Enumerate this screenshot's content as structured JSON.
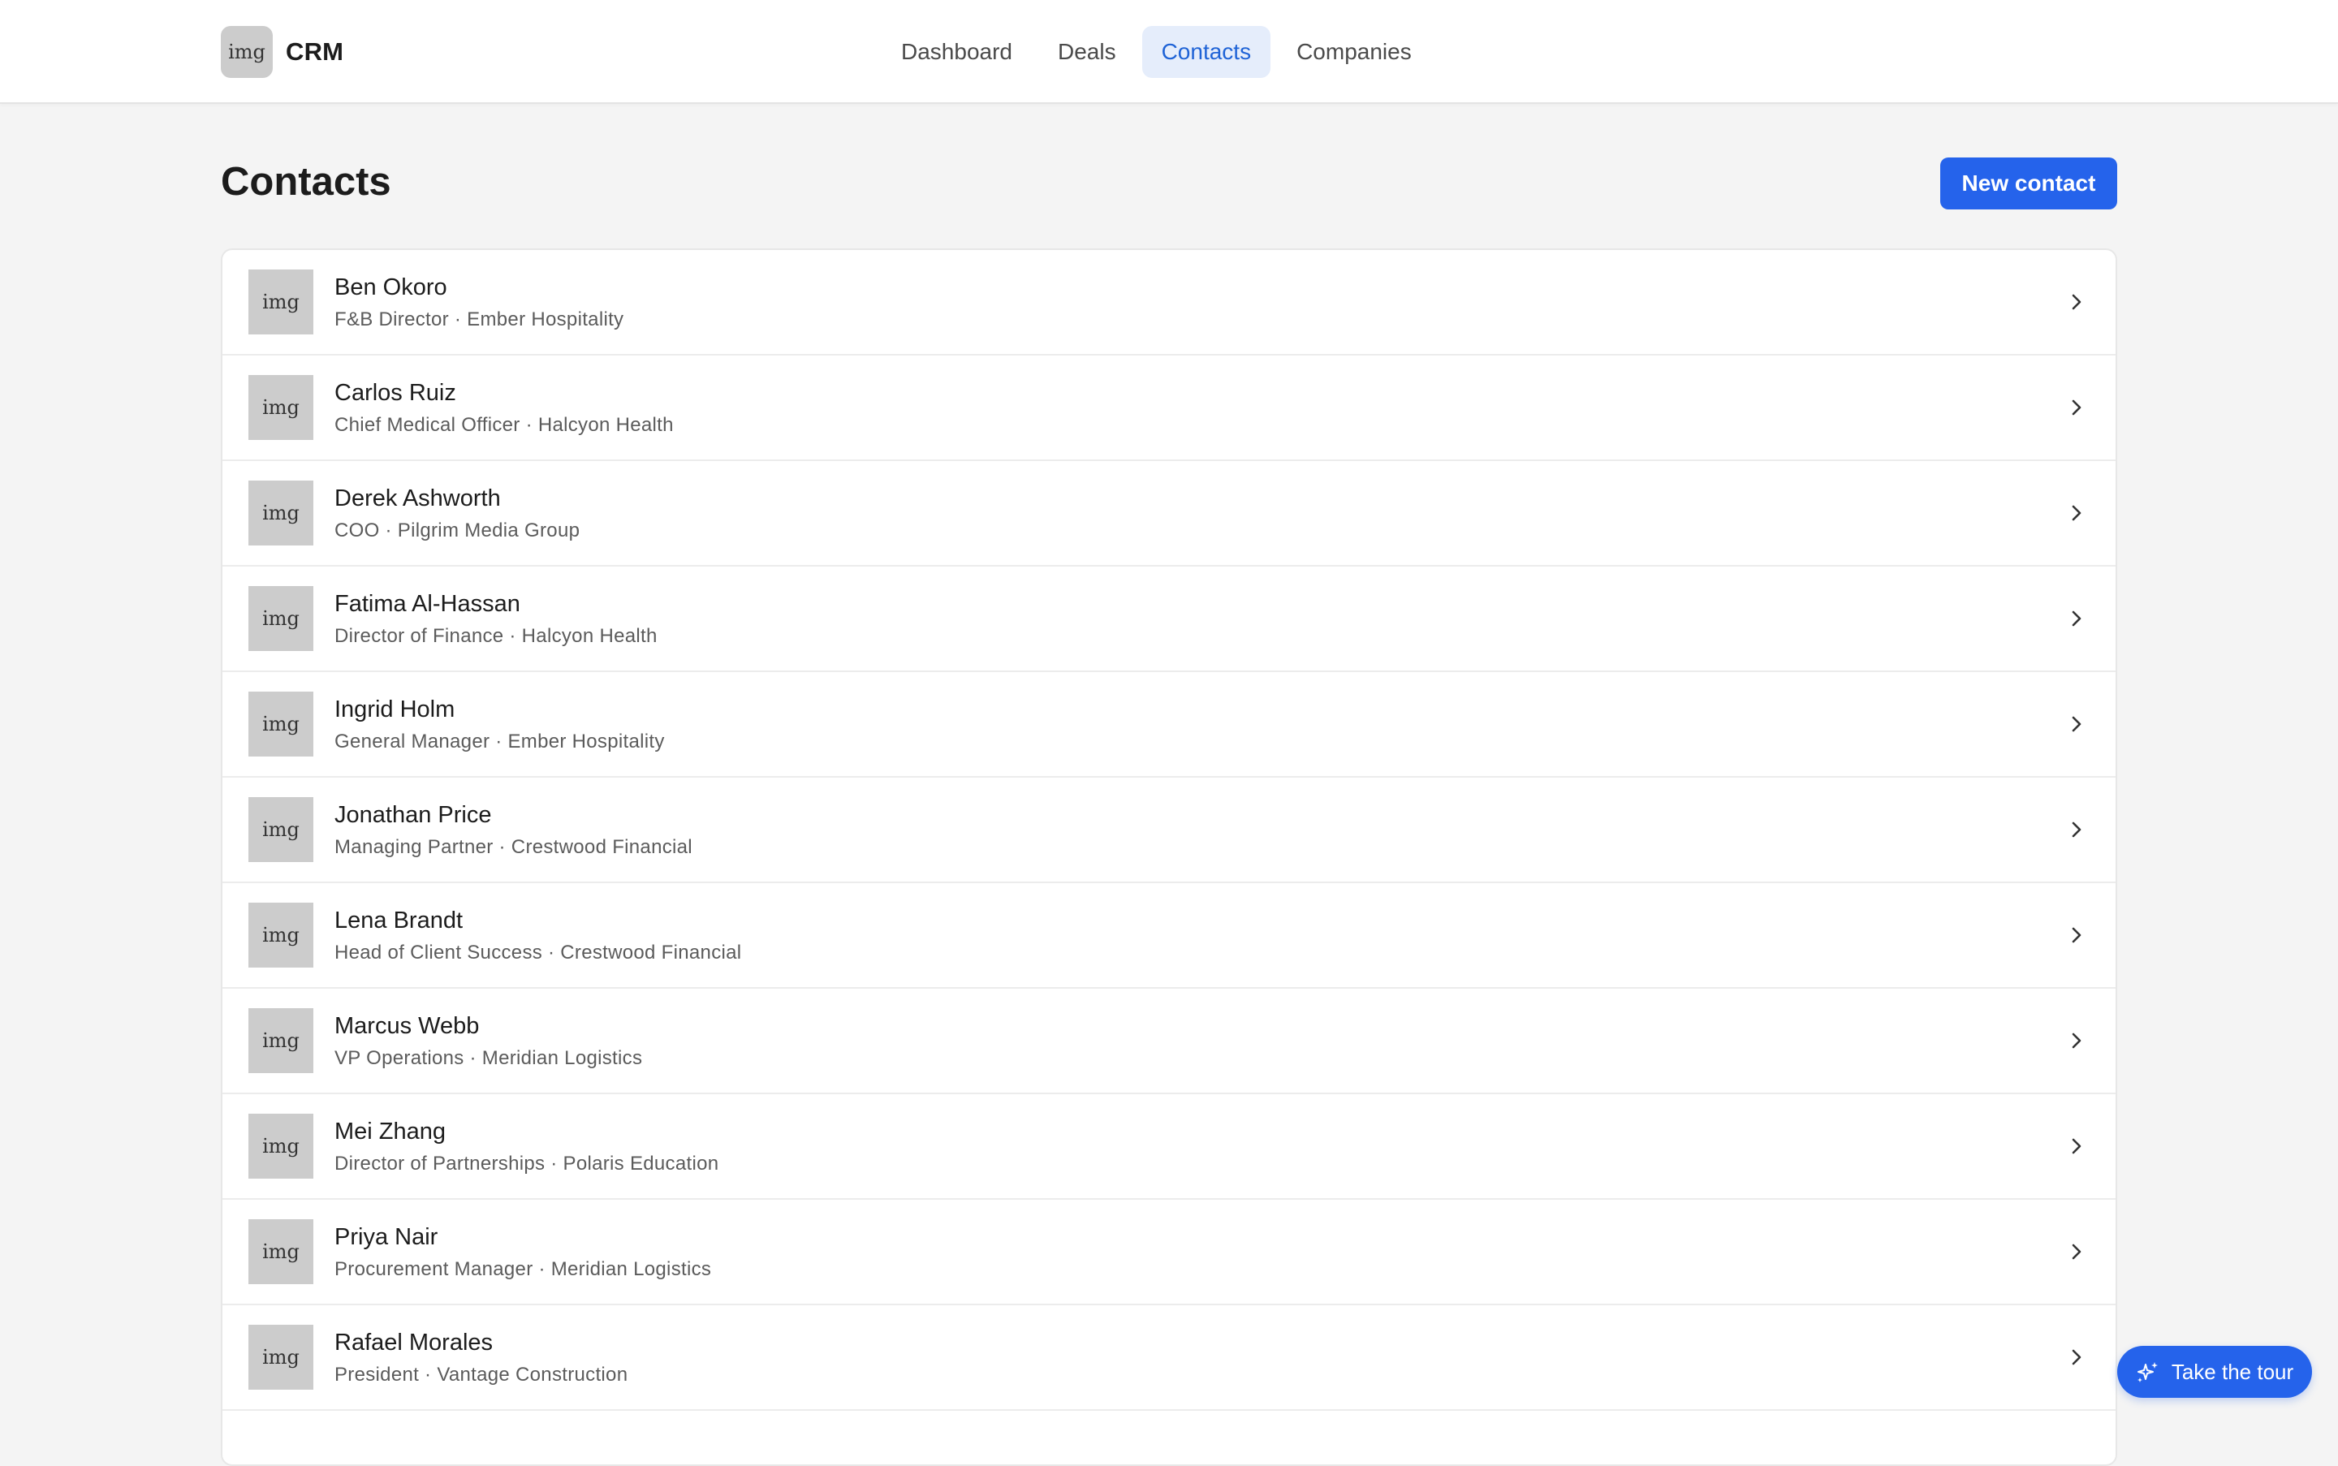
{
  "header": {
    "logo_text": "img",
    "app_name": "CRM",
    "nav": [
      {
        "label": "Dashboard",
        "active": false
      },
      {
        "label": "Deals",
        "active": false
      },
      {
        "label": "Contacts",
        "active": true
      },
      {
        "label": "Companies",
        "active": false
      }
    ]
  },
  "main": {
    "title": "Contacts",
    "new_button": "New contact",
    "contacts": [
      {
        "avatar": "img",
        "name": "Ben Okoro",
        "subtitle": "F&B Director · Ember Hospitality"
      },
      {
        "avatar": "img",
        "name": "Carlos Ruiz",
        "subtitle": "Chief Medical Officer · Halcyon Health"
      },
      {
        "avatar": "img",
        "name": "Derek Ashworth",
        "subtitle": "COO · Pilgrim Media Group"
      },
      {
        "avatar": "img",
        "name": "Fatima Al-Hassan",
        "subtitle": "Director of Finance · Halcyon Health"
      },
      {
        "avatar": "img",
        "name": "Ingrid Holm",
        "subtitle": "General Manager · Ember Hospitality"
      },
      {
        "avatar": "img",
        "name": "Jonathan Price",
        "subtitle": "Managing Partner · Crestwood Financial"
      },
      {
        "avatar": "img",
        "name": "Lena Brandt",
        "subtitle": "Head of Client Success · Crestwood Financial"
      },
      {
        "avatar": "img",
        "name": "Marcus Webb",
        "subtitle": "VP Operations · Meridian Logistics"
      },
      {
        "avatar": "img",
        "name": "Mei Zhang",
        "subtitle": "Director of Partnerships · Polaris Education"
      },
      {
        "avatar": "img",
        "name": "Priya Nair",
        "subtitle": "Procurement Manager · Meridian Logistics"
      },
      {
        "avatar": "img",
        "name": "Rafael Morales",
        "subtitle": "President · Vantage Construction"
      }
    ]
  },
  "tour": {
    "label": "Take the tour",
    "icon": "sparkles-icon"
  },
  "colors": {
    "accent": "#2563eb",
    "nav_active_bg": "#e5edfb",
    "nav_active_text": "#1f63d6",
    "background": "#f4f4f4"
  }
}
